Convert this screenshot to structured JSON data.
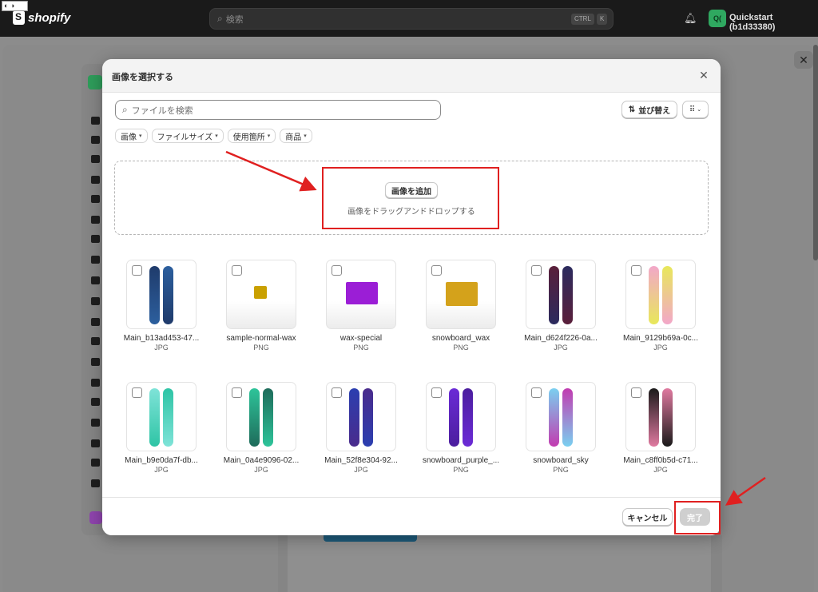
{
  "topbar": {
    "brand": "shopify",
    "search_placeholder": "検索",
    "kbd_ctrl": "CTRL",
    "kbd_k": "K",
    "store_initials": "Q(",
    "store_name": "Quickstart (b1d33380)"
  },
  "modal": {
    "title": "画像を選択する",
    "search_placeholder": "ファイルを検索",
    "sort_label": "並び替え",
    "filters": [
      "画像",
      "ファイルサイズ",
      "使用箇所",
      "商品"
    ],
    "add_button": "画像を追加",
    "drop_text": "画像をドラッグアンドドロップする",
    "cancel": "キャンセル",
    "done": "完了"
  },
  "files": [
    {
      "name": "Main_b13ad453-47...",
      "type": "JPG",
      "kind": "board",
      "colors": [
        "#1f3b6b",
        "#2c5f9e"
      ]
    },
    {
      "name": "sample-normal-wax",
      "type": "PNG",
      "kind": "wax",
      "colors": [
        "#c9a000"
      ]
    },
    {
      "name": "wax-special",
      "type": "PNG",
      "kind": "wax",
      "colors": [
        "#9b1ed6"
      ]
    },
    {
      "name": "snowboard_wax",
      "type": "PNG",
      "kind": "wax",
      "colors": [
        "#d4a21b"
      ]
    },
    {
      "name": "Main_d624f226-0a...",
      "type": "JPG",
      "kind": "board",
      "colors": [
        "#5a1f3a",
        "#2b2b5e"
      ]
    },
    {
      "name": "Main_9129b69a-0c...",
      "type": "JPG",
      "kind": "board",
      "colors": [
        "#f2a7c9",
        "#e8e85a"
      ]
    },
    {
      "name": "Main_b9e0da7f-db...",
      "type": "JPG",
      "kind": "board",
      "colors": [
        "#7fe3d8",
        "#2ec4a5"
      ]
    },
    {
      "name": "Main_0a4e9096-02...",
      "type": "JPG",
      "kind": "board",
      "colors": [
        "#2ec49a",
        "#1e6b5a"
      ]
    },
    {
      "name": "Main_52f8e304-92...",
      "type": "JPG",
      "kind": "board",
      "colors": [
        "#2b3fb0",
        "#4a2b8c"
      ]
    },
    {
      "name": "snowboard_purple_...",
      "type": "PNG",
      "kind": "board",
      "colors": [
        "#6b2bd6",
        "#4b1e9e"
      ]
    },
    {
      "name": "snowboard_sky",
      "type": "PNG",
      "kind": "board",
      "colors": [
        "#7ad0f0",
        "#c23bb0"
      ]
    },
    {
      "name": "Main_c8ff0b5d-c71...",
      "type": "JPG",
      "kind": "board",
      "colors": [
        "#1a1a1a",
        "#e07aa0"
      ]
    }
  ]
}
